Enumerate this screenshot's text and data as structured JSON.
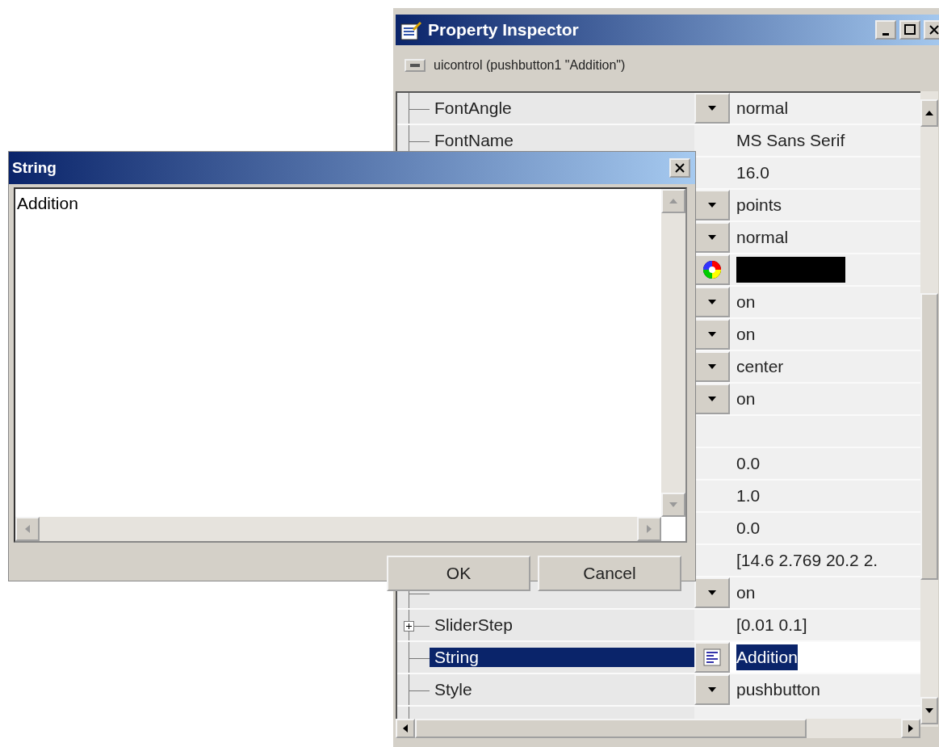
{
  "inspector": {
    "title": "Property Inspector",
    "subject": "uicontrol (pushbutton1 \"Addition\")",
    "rows": [
      {
        "name": "FontAngle",
        "kind": "dropdown",
        "value": "normal",
        "selected": false,
        "expandable": false
      },
      {
        "name": "FontName",
        "kind": "plain",
        "value": "MS Sans Serif",
        "selected": false,
        "expandable": false
      },
      {
        "kind": "plain",
        "value": "16.0",
        "selected": false,
        "expandable": false
      },
      {
        "kind": "dropdown",
        "value": "points",
        "selected": false,
        "expandable": false
      },
      {
        "kind": "dropdown",
        "value": "normal",
        "selected": false,
        "expandable": false
      },
      {
        "kind": "color",
        "color": "#000000",
        "selected": false,
        "expandable": false
      },
      {
        "kind": "dropdown",
        "value": "on",
        "selected": false,
        "expandable": false
      },
      {
        "kind": "dropdown",
        "value": "on",
        "selected": false,
        "expandable": false
      },
      {
        "kind": "dropdown",
        "value": "center",
        "selected": false,
        "expandable": false
      },
      {
        "kind": "dropdown",
        "value": "on",
        "selected": false,
        "expandable": false
      },
      {
        "kind": "plain",
        "selected": false,
        "expandable": false
      },
      {
        "kind": "plain",
        "value": "0.0",
        "selected": false,
        "expandable": false
      },
      {
        "kind": "plain",
        "value": "1.0",
        "selected": false,
        "expandable": false
      },
      {
        "kind": "plain",
        "value": "0.0",
        "selected": false,
        "expandable": false
      },
      {
        "kind": "plain",
        "value": "[14.6 2.769 20.2 2.",
        "selected": false,
        "expandable": false
      },
      {
        "kind": "dropdown",
        "value": "on",
        "selected": false,
        "expandable": false
      },
      {
        "name": "SliderStep",
        "kind": "plain",
        "value": "[0.01 0.1]",
        "selected": false,
        "expandable": true
      },
      {
        "name": "String",
        "kind": "editor",
        "value": "Addition",
        "selected": true,
        "expandable": false
      },
      {
        "name": "Style",
        "kind": "dropdown",
        "value": "pushbutton",
        "selected": false,
        "expandable": false
      },
      {
        "kind": "plain",
        "selected": false,
        "expandable": false
      }
    ]
  },
  "dialog": {
    "title": "String",
    "text": "Addition",
    "buttons": [
      "OK",
      "Cancel"
    ]
  }
}
